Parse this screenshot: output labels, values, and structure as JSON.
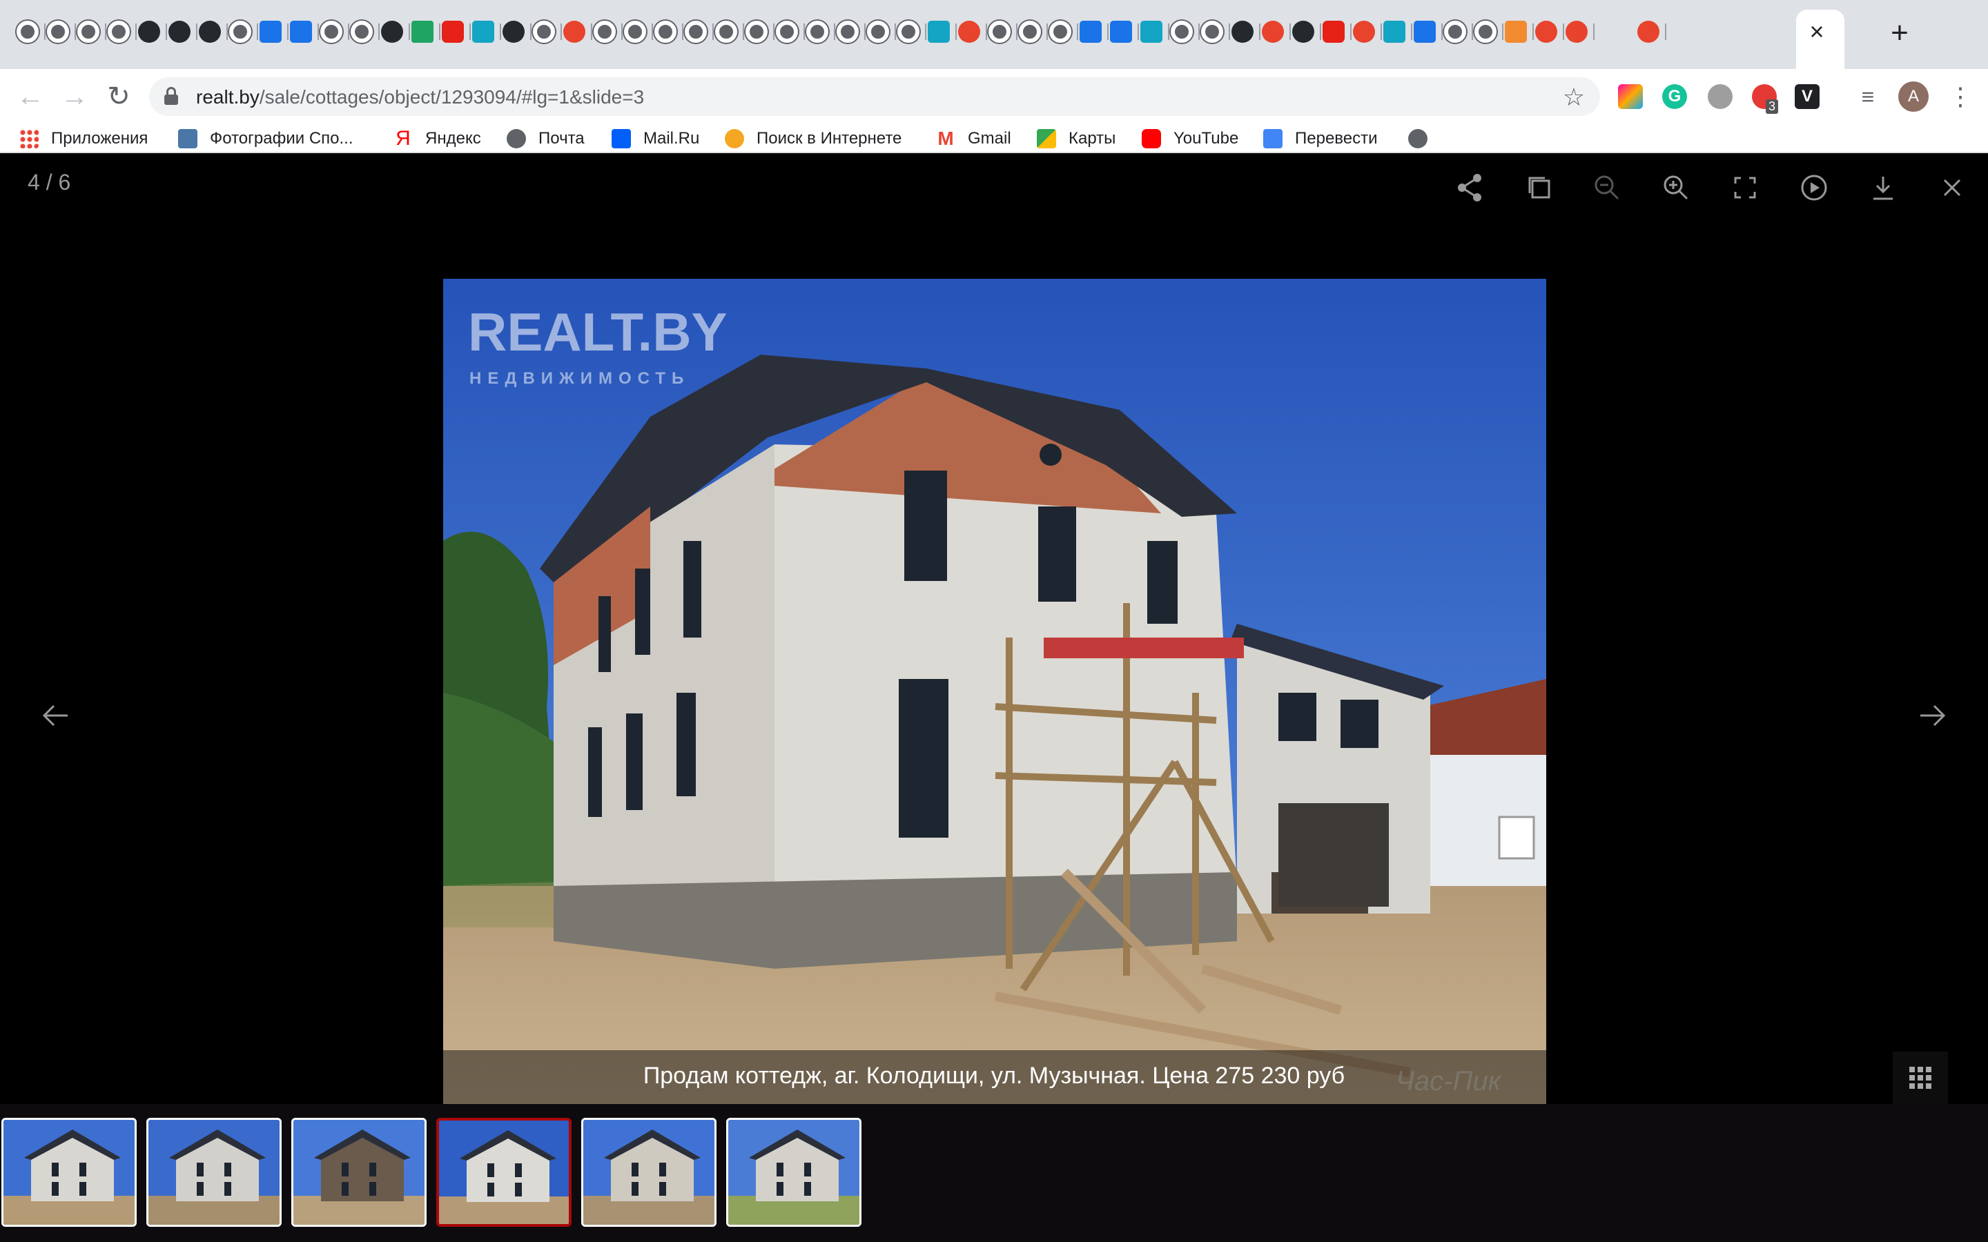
{
  "browser": {
    "url_host": "realt.by",
    "url_path": "/sale/cottages/object/1293094/#lg=1&slide=3",
    "close_tab_label": "×",
    "new_tab_label": "+",
    "avatar_letter": "A",
    "ext_badge": "3"
  },
  "bookmarks": [
    {
      "label": "Приложения",
      "icon": "apps-grid-icon",
      "color": "#ea4335"
    },
    {
      "label": "Фотографии Спо...",
      "icon": "vk-icon",
      "color": "#4a76a8"
    },
    {
      "label": "Яндекс",
      "icon": "yandex-icon",
      "color": "#ff0000"
    },
    {
      "label": "Почта",
      "icon": "globe-icon",
      "color": "#5f6368"
    },
    {
      "label": "Mail.Ru",
      "icon": "mailru-icon",
      "color": "#005ff9"
    },
    {
      "label": "Поиск в Интернете",
      "icon": "search-mail-icon",
      "color": "#f5a623"
    },
    {
      "label": "Gmail",
      "icon": "gmail-icon",
      "color": "#ea4335"
    },
    {
      "label": "Карты",
      "icon": "maps-icon",
      "color": "#34a853"
    },
    {
      "label": "YouTube",
      "icon": "youtube-icon",
      "color": "#ff0000"
    },
    {
      "label": "Перевести",
      "icon": "translate-icon",
      "color": "#4285f4"
    }
  ],
  "viewer": {
    "counter": "4 / 6",
    "caption": "Продам коттедж, аг. Колодищи, ул. Музычная. Цена 275 230 руб",
    "watermark_top": "REALT.BY",
    "watermark_top_sub": "НЕДВИЖИМОСТЬ",
    "watermark_bottom": "Час-Пик",
    "thumbnail_count": 6,
    "active_thumbnail": 4
  },
  "colors": {
    "tabstrip": "#dee1e6",
    "viewer_bg": "#000000",
    "thumb_active_border": "#a90707",
    "sky": "#2f5fc4"
  }
}
